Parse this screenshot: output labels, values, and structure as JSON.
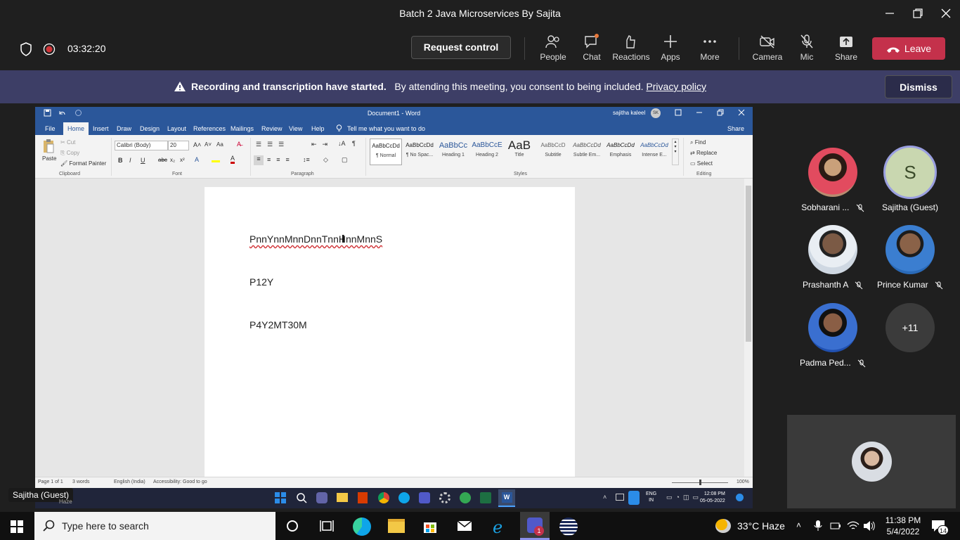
{
  "window": {
    "title": "Batch 2 Java Microservices By Sajita"
  },
  "meeting": {
    "timer": "03:32:20",
    "request_control": "Request control",
    "buttons": [
      {
        "label": "People",
        "icon": "people-icon"
      },
      {
        "label": "Chat",
        "icon": "chat-icon"
      },
      {
        "label": "Reactions",
        "icon": "reactions-icon"
      },
      {
        "label": "Apps",
        "icon": "apps-icon"
      },
      {
        "label": "More",
        "icon": "more-icon"
      },
      {
        "label": "Camera",
        "icon": "camera-off-icon"
      },
      {
        "label": "Mic",
        "icon": "mic-off-icon"
      },
      {
        "label": "Share",
        "icon": "share-icon"
      }
    ],
    "leave": "Leave",
    "leave_color": "#c4314b"
  },
  "banner": {
    "bold": "Recording and transcription have started.",
    "text": "By attending this meeting, you consent to being included.",
    "link": "Privacy policy",
    "dismiss": "Dismiss",
    "color": "#3d3e66"
  },
  "word": {
    "title": "Document1 - Word",
    "user": "sajitha kaleel",
    "user_initials": "SK",
    "tabs": [
      "File",
      "Home",
      "Insert",
      "Draw",
      "Design",
      "Layout",
      "References",
      "Mailings",
      "Review",
      "View",
      "Help"
    ],
    "tell_me": "Tell me what you want to do",
    "share": "Share",
    "clipboard": {
      "paste": "Paste",
      "cut": "Cut",
      "copy": "Copy",
      "format_painter": "Format Painter",
      "label": "Clipboard"
    },
    "font": {
      "name": "Calibri (Body)",
      "size": "20",
      "label": "Font"
    },
    "paragraph_label": "Paragraph",
    "styles": [
      {
        "preview": "AaBbCcDd",
        "name": "¶ Normal"
      },
      {
        "preview": "AaBbCcDd",
        "name": "¶ No Spac..."
      },
      {
        "preview": "AaBbCc",
        "name": "Heading 1"
      },
      {
        "preview": "AaBbCcE",
        "name": "Heading 2"
      },
      {
        "preview": "AaB",
        "name": "Title"
      },
      {
        "preview": "AaBbCcD",
        "name": "Subtitle"
      },
      {
        "preview": "AaBbCcDd",
        "name": "Subtle Em..."
      },
      {
        "preview": "AaBbCcDd",
        "name": "Emphasis"
      },
      {
        "preview": "AaBbCcDd",
        "name": "Intense E..."
      }
    ],
    "styles_label": "Styles",
    "editing": {
      "find": "Find",
      "replace": "Replace",
      "select": "Select",
      "label": "Editing"
    },
    "lines": [
      "PnnYnnMnnDnnTnnHnnMnnS",
      "P12Y",
      "P4Y2MT30M"
    ],
    "status": {
      "page": "Page 1 of 1",
      "words": "3 words",
      "language": "English (India)",
      "accessibility": "Accessibility: Good to go",
      "zoom": "100%"
    },
    "tray": {
      "lang1": "ENG",
      "lang2": "IN",
      "time": "12:08 PM",
      "date": "05-05-2022"
    },
    "theme_color": "#2b579a"
  },
  "presenter_label": "Sajitha (Guest)",
  "weather_small": "Haze",
  "participants": [
    {
      "name": "Sobharani ...",
      "muted": true
    },
    {
      "name": "Sajitha (Guest)",
      "initial": "S",
      "muted": false
    },
    {
      "name": "Prashanth A",
      "muted": true
    },
    {
      "name": "Prince Kumar",
      "muted": true
    },
    {
      "name": "Padma Ped...",
      "muted": true
    },
    {
      "name": "+11",
      "muted": false
    }
  ],
  "taskbar": {
    "search_placeholder": "Type here to search",
    "weather": "33°C  Haze",
    "time": "11:38 PM",
    "date": "5/4/2022",
    "notifications": "14",
    "teams_badge": "1"
  }
}
